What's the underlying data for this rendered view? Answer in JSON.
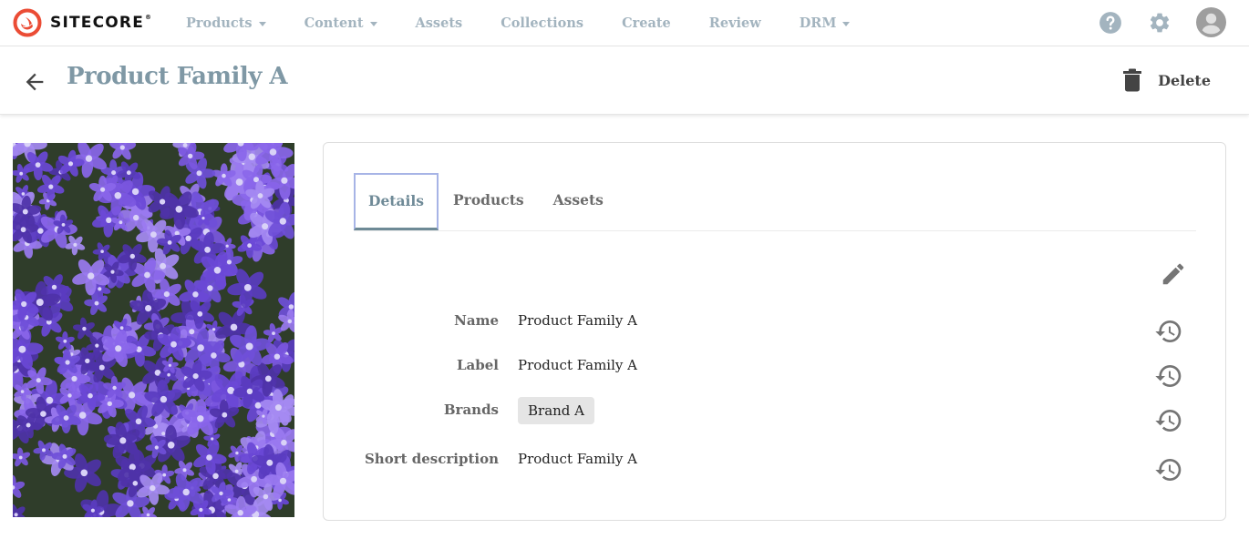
{
  "brand": {
    "name": "SITECORE",
    "trademark": "®",
    "logo_color": "#eb4c35"
  },
  "nav": {
    "items": [
      {
        "label": "Products",
        "has_dropdown": true
      },
      {
        "label": "Content",
        "has_dropdown": true
      },
      {
        "label": "Assets",
        "has_dropdown": false
      },
      {
        "label": "Collections",
        "has_dropdown": false
      },
      {
        "label": "Create",
        "has_dropdown": false
      },
      {
        "label": "Review",
        "has_dropdown": false
      },
      {
        "label": "DRM",
        "has_dropdown": true
      }
    ],
    "icons": [
      "help-icon",
      "settings-icon",
      "user-avatar-icon"
    ]
  },
  "header": {
    "back_icon": "arrow-left-icon",
    "title": "Product Family A",
    "delete_label": "Delete",
    "delete_icon": "trash-icon"
  },
  "image": {
    "alt": "Purple bellflowers",
    "dominant_color": "#6a4bd0"
  },
  "tabs": [
    {
      "label": "Details",
      "active": true
    },
    {
      "label": "Products",
      "active": false
    },
    {
      "label": "Assets",
      "active": false
    }
  ],
  "details": {
    "edit_icon": "pencil-icon",
    "fields": [
      {
        "label": "Name",
        "value": "Product Family A",
        "type": "text"
      },
      {
        "label": "Label",
        "value": "Product Family A",
        "type": "text"
      },
      {
        "label": "Brands",
        "value": "Brand A",
        "type": "chip"
      },
      {
        "label": "Short description",
        "value": "Product Family A",
        "type": "text"
      }
    ],
    "history_icon": "history-icon"
  },
  "colors": {
    "nav_text": "#a3b4bf",
    "title_text": "#7f98a5",
    "active_tab_text": "#6f8a97",
    "active_tab_border": "#a7b4e6",
    "active_tab_underline": "#6e8a96",
    "icon_grey": "#757575"
  }
}
